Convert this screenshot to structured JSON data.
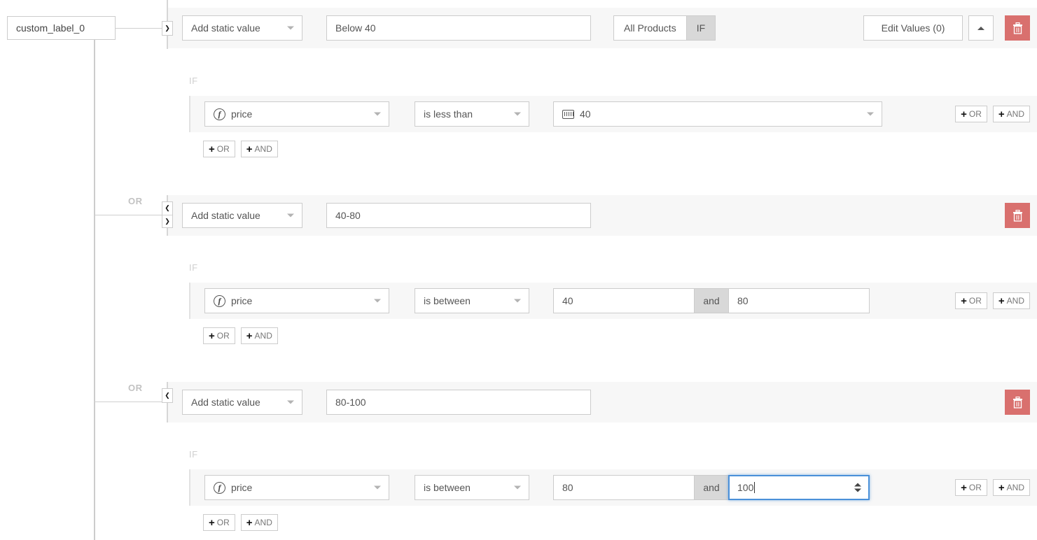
{
  "label_chip": {
    "text": "custom_label_0"
  },
  "toolbar": {
    "all_products_label": "All Products",
    "if_label": "IF",
    "edit_values_label": "Edit Values (0)",
    "collapse_icon": "caret-up-icon",
    "delete_icon": "trash-icon"
  },
  "connector": {
    "or_label": "OR"
  },
  "section_label": {
    "if": "IF"
  },
  "add_buttons": {
    "or": "OR",
    "and": "AND",
    "plus": "+"
  },
  "colors": {
    "delete_button": "#d9706e",
    "focus_border": "#4a90d9",
    "row_background": "#f7f7f7",
    "segment_active": "#d8d8d8"
  },
  "rows": [
    {
      "value_source_label": "Add static value",
      "value": "40-80",
      "reorder": "dual",
      "conditions": [
        {
          "field": "price",
          "field_icon": "function-icon",
          "operator": "is less than",
          "value": "40",
          "value_icon": "keyboard-icon",
          "value_type": "select"
        }
      ]
    }
  ],
  "groups": [
    {
      "id": "group-1",
      "value_source_label": "Add static value",
      "value": "Below 40",
      "reorder": "down-only",
      "if_label": "IF",
      "condition": {
        "field": "price",
        "operator": "is less than",
        "value": "40",
        "value_type": "select",
        "value_icon": "keyboard-icon"
      }
    },
    {
      "id": "group-2",
      "value_source_label": "Add static value",
      "value": "40-80",
      "reorder": "up-down",
      "if_label": "IF",
      "condition": {
        "field": "price",
        "operator": "is between",
        "value_from": "40",
        "value_to": "80",
        "and_label": "and",
        "value_type": "between"
      }
    },
    {
      "id": "group-3",
      "value_source_label": "Add static value",
      "value": "80-100",
      "reorder": "up-only",
      "if_label": "IF",
      "condition": {
        "field": "price",
        "operator": "is between",
        "value_from": "80",
        "value_to": "100",
        "and_label": "and",
        "value_type": "between",
        "focused_field": "value_to"
      }
    }
  ]
}
